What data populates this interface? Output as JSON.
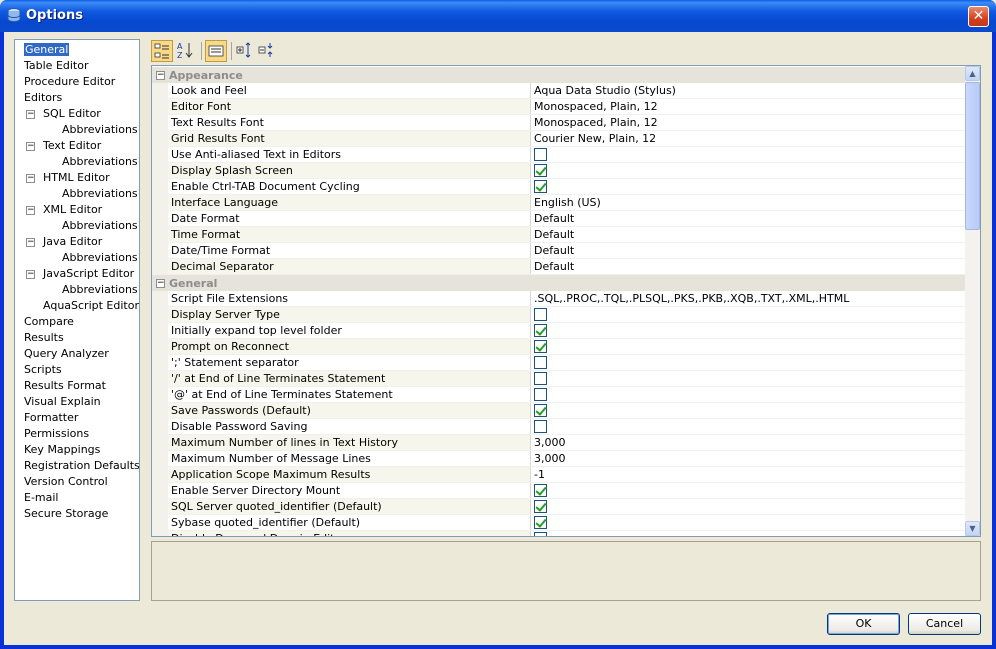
{
  "window": {
    "title": "Options",
    "close_label": "✕"
  },
  "tree": {
    "nodes": [
      {
        "label": "General",
        "level": 0,
        "selected": true
      },
      {
        "label": "Table Editor",
        "level": 0
      },
      {
        "label": "Procedure Editor",
        "level": 0
      },
      {
        "label": "Editors",
        "level": 0
      },
      {
        "label": "SQL Editor",
        "level": 1,
        "expander": "−"
      },
      {
        "label": "Abbreviations",
        "level": 2
      },
      {
        "label": "Text Editor",
        "level": 1,
        "expander": "−"
      },
      {
        "label": "Abbreviations",
        "level": 2
      },
      {
        "label": "HTML Editor",
        "level": 1,
        "expander": "−"
      },
      {
        "label": "Abbreviations",
        "level": 2
      },
      {
        "label": "XML Editor",
        "level": 1,
        "expander": "−"
      },
      {
        "label": "Abbreviations",
        "level": 2
      },
      {
        "label": "Java Editor",
        "level": 1,
        "expander": "−"
      },
      {
        "label": "Abbreviations",
        "level": 2
      },
      {
        "label": "JavaScript Editor",
        "level": 1,
        "expander": "−"
      },
      {
        "label": "Abbreviations",
        "level": 2
      },
      {
        "label": "AquaScript Editor",
        "level": 1
      },
      {
        "label": "Compare",
        "level": 0
      },
      {
        "label": "Results",
        "level": 0
      },
      {
        "label": "Query Analyzer",
        "level": 0
      },
      {
        "label": "Scripts",
        "level": 0
      },
      {
        "label": "Results Format",
        "level": 0
      },
      {
        "label": "Visual Explain",
        "level": 0
      },
      {
        "label": "Formatter",
        "level": 0
      },
      {
        "label": "Permissions",
        "level": 0
      },
      {
        "label": "Key Mappings",
        "level": 0
      },
      {
        "label": "Registration Defaults",
        "level": 0
      },
      {
        "label": "Version Control",
        "level": 0
      },
      {
        "label": "E-mail",
        "level": 0
      },
      {
        "label": "Secure Storage",
        "level": 0
      }
    ]
  },
  "toolbar": {
    "buttons": [
      {
        "name": "categorized-view-icon",
        "active": true
      },
      {
        "name": "sort-alphabetical-icon",
        "active": false
      },
      {
        "name": "show-description-icon",
        "active": true
      },
      {
        "name": "expand-all-icon",
        "active": false
      },
      {
        "name": "collapse-all-icon",
        "active": false
      }
    ]
  },
  "properties": {
    "categories": [
      {
        "name": "Appearance",
        "expander": "−",
        "rows": [
          {
            "name": "Look and Feel",
            "type": "text",
            "value": "Aqua Data Studio (Stylus)"
          },
          {
            "name": "Editor Font",
            "type": "text",
            "value": "Monospaced, Plain, 12"
          },
          {
            "name": "Text Results Font",
            "type": "text",
            "value": "Monospaced, Plain, 12"
          },
          {
            "name": "Grid Results Font",
            "type": "text",
            "value": "Courier New, Plain, 12"
          },
          {
            "name": "Use Anti-aliased Text in Editors",
            "type": "check",
            "checked": false
          },
          {
            "name": "Display Splash Screen",
            "type": "check",
            "checked": true
          },
          {
            "name": "Enable Ctrl-TAB Document Cycling",
            "type": "check",
            "checked": true
          },
          {
            "name": "Interface Language",
            "type": "text",
            "value": "English (US)"
          },
          {
            "name": "Date Format",
            "type": "text",
            "value": "Default"
          },
          {
            "name": "Time Format",
            "type": "text",
            "value": "Default"
          },
          {
            "name": "Date/Time Format",
            "type": "text",
            "value": "Default"
          },
          {
            "name": "Decimal Separator",
            "type": "text",
            "value": "Default"
          }
        ]
      },
      {
        "name": "General",
        "expander": "−",
        "rows": [
          {
            "name": "Script File Extensions",
            "type": "text",
            "value": ".SQL,.PROC,.TQL,.PLSQL,.PKS,.PKB,.XQB,.TXT,.XML,.HTML"
          },
          {
            "name": "Display Server Type",
            "type": "check",
            "checked": false
          },
          {
            "name": "Initially expand top level folder",
            "type": "check",
            "checked": true
          },
          {
            "name": "Prompt on Reconnect",
            "type": "check",
            "checked": true
          },
          {
            "name": "';' Statement separator",
            "type": "check",
            "checked": false
          },
          {
            "name": "'/' at End of Line Terminates Statement",
            "type": "check",
            "checked": false
          },
          {
            "name": "'@' at End of Line Terminates Statement",
            "type": "check",
            "checked": false
          },
          {
            "name": "Save Passwords (Default)",
            "type": "check",
            "checked": true
          },
          {
            "name": "Disable Password Saving",
            "type": "check",
            "checked": false
          },
          {
            "name": "Maximum Number of lines in Text History",
            "type": "text",
            "value": "3,000"
          },
          {
            "name": "Maximum Number of Message Lines",
            "type": "text",
            "value": "3,000"
          },
          {
            "name": "Application Scope Maximum Results",
            "type": "text",
            "value": "-1"
          },
          {
            "name": "Enable Server Directory Mount",
            "type": "check",
            "checked": true
          },
          {
            "name": "SQL Server quoted_identifier (Default)",
            "type": "check",
            "checked": true
          },
          {
            "name": "Sybase quoted_identifier (Default)",
            "type": "check",
            "checked": true
          },
          {
            "name": "Disable Drag and Drop in Editor",
            "type": "check",
            "checked": false
          }
        ]
      }
    ]
  },
  "buttons": {
    "ok": "OK",
    "cancel": "Cancel"
  }
}
